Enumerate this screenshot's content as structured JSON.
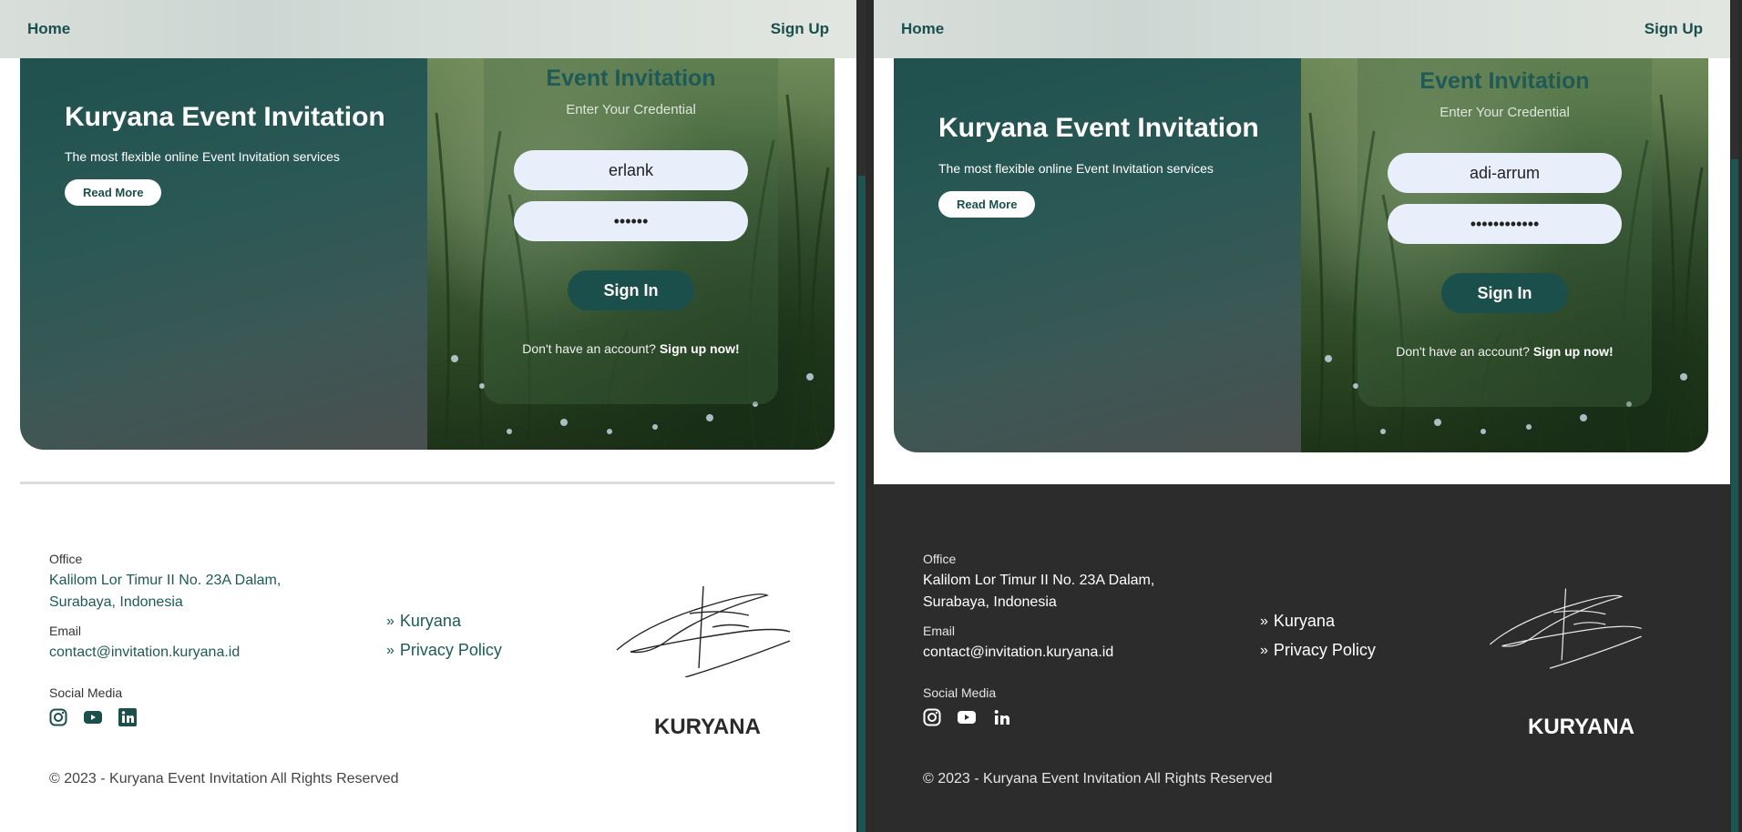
{
  "panes": {
    "left": {
      "nav": {
        "home": "Home",
        "signup": "Sign Up"
      },
      "hero": {
        "title": "Kuryana Event Invitation",
        "subtitle": "The most flexible online Event Invitation services",
        "read_more": "Read More"
      },
      "login": {
        "title": "Event Invitation",
        "subtitle": "Enter Your Credential",
        "username": "erlank",
        "password": "••••••",
        "signin": "Sign In",
        "no_account": "Don't have an account?",
        "signup_now": "Sign up now!"
      },
      "footer": {
        "theme": "light",
        "office_label": "Office",
        "office_line1": "Kalilom Lor Timur II No. 23A Dalam,",
        "office_line2": "Surabaya, Indonesia",
        "email_label": "Email",
        "email": "contact@invitation.kuryana.id",
        "social_label": "Social Media",
        "social_icons": [
          "instagram-icon",
          "youtube-icon",
          "linkedin-icon"
        ],
        "links": [
          "Kuryana",
          "Privacy Policy"
        ],
        "brand": "KURYANA",
        "copyright": "© 2023 - Kuryana Event Invitation All Rights Reserved"
      }
    },
    "right": {
      "nav": {
        "home": "Home",
        "signup": "Sign Up"
      },
      "hero": {
        "title": "Kuryana Event Invitation",
        "subtitle": "The most flexible online Event Invitation services",
        "read_more": "Read More"
      },
      "login": {
        "title": "Event Invitation",
        "subtitle": "Enter Your Credential",
        "username": "adi-arrum",
        "password": "••••••••••••",
        "signin": "Sign In",
        "no_account": "Don't have an account?",
        "signup_now": "Sign up now!"
      },
      "footer": {
        "theme": "dark",
        "office_label": "Office",
        "office_line1": "Kalilom Lor Timur II No. 23A Dalam,",
        "office_line2": "Surabaya, Indonesia",
        "email_label": "Email",
        "email": "contact@invitation.kuryana.id",
        "social_label": "Social Media",
        "social_icons": [
          "instagram-icon",
          "youtube-icon",
          "linkedin-icon"
        ],
        "links": [
          "Kuryana",
          "Privacy Policy"
        ],
        "brand": "KURYANA",
        "copyright": "© 2023 - Kuryana Event Invitation All Rights Reserved"
      }
    }
  },
  "colors": {
    "brand_teal": "#1b4f4c",
    "field_bg": "#e8effa",
    "dark_footer": "#2c2c2c"
  }
}
